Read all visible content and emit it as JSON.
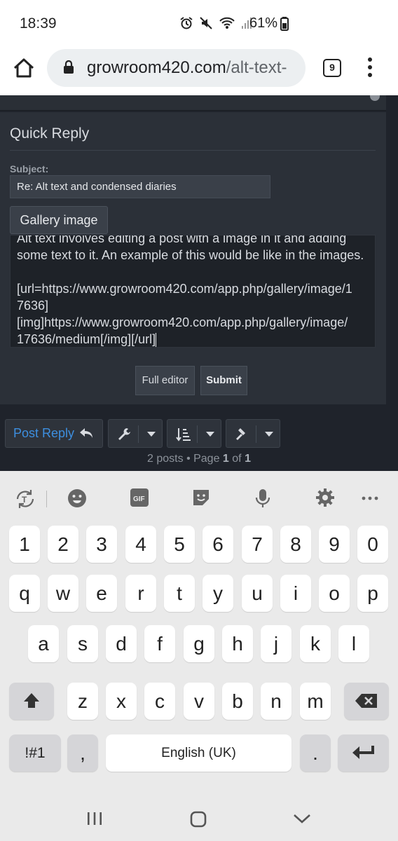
{
  "status_bar": {
    "time": "18:39",
    "battery": "61%"
  },
  "browser": {
    "url_host": "growroom420.com",
    "url_path": "/alt-text-",
    "tab_count": "9"
  },
  "quick_reply": {
    "title": "Quick Reply",
    "subject_label": "Subject:",
    "subject_value": "Re: Alt text and condensed diaries",
    "gallery_button": "Gallery image",
    "message_lines": [
      "Alt text involves editing a post with a image in it and adding",
      "some text to it. An example of this would be like in the images.",
      "",
      "[url=https://www.growroom420.com/app.php/gallery/image/1",
      "7636]",
      "[img]https://www.growroom420.com/app.php/gallery/image/",
      "17636/medium[/img][/url]"
    ],
    "full_editor_button": "Full editor",
    "submit_button": "Submit"
  },
  "actions": {
    "post_reply": "Post Reply"
  },
  "pagination": {
    "prefix": "2 posts • Page ",
    "current": "1",
    "middle": " of ",
    "total": "1"
  },
  "keyboard": {
    "number_row": [
      "1",
      "2",
      "3",
      "4",
      "5",
      "6",
      "7",
      "8",
      "9",
      "0"
    ],
    "row_q": [
      "q",
      "w",
      "e",
      "r",
      "t",
      "y",
      "u",
      "i",
      "o",
      "p"
    ],
    "row_a": [
      "a",
      "s",
      "d",
      "f",
      "g",
      "h",
      "j",
      "k",
      "l"
    ],
    "row_z": [
      "z",
      "x",
      "c",
      "v",
      "b",
      "n",
      "m"
    ],
    "symbols_key": "!#1",
    "comma_key": ",",
    "space_key": "English (UK)",
    "period_key": "."
  },
  "colors": {
    "page_bg": "#1f232b",
    "panel_bg": "#2b3038",
    "link_blue": "#3d8fe0",
    "keyboard_bg": "#eaeaea"
  }
}
